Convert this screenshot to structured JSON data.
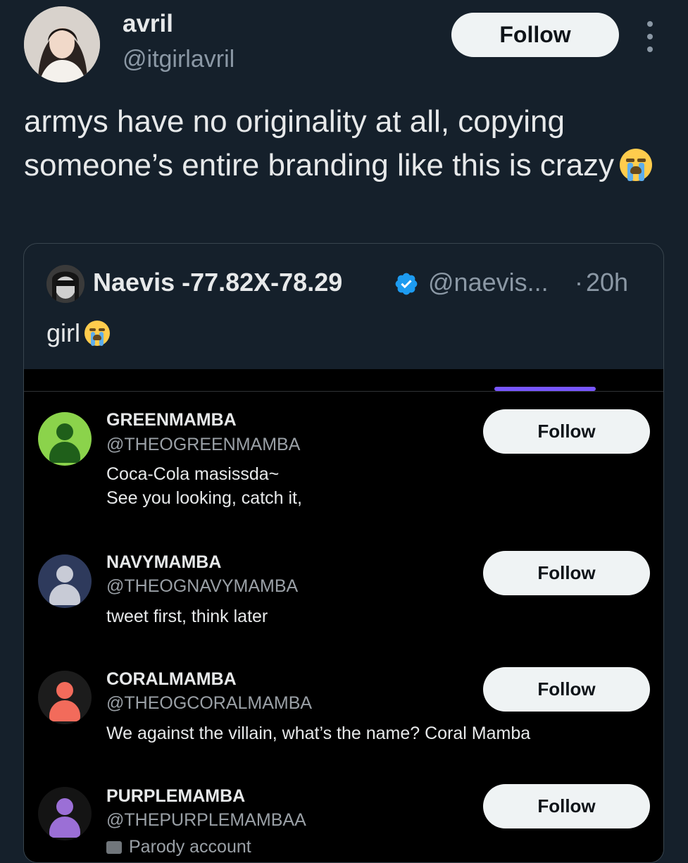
{
  "author": {
    "display_name": "avril",
    "handle": "@itgirlavril",
    "follow_label": "Follow"
  },
  "tweet": {
    "text": "armys have no originality at all, copying someone’s entire branding like this is crazy",
    "emoji": "loudly-crying-face"
  },
  "quoted": {
    "display_name": "Naevis -77.82X-78.29",
    "handle": "@naevis...",
    "separator": "·",
    "time": "20h",
    "text": "girl",
    "emoji": "loudly-crying-face",
    "verified_color": "#1d9bf0",
    "accounts": [
      {
        "name": "GREENMAMBA",
        "handle": "@THEOGREENMAMBA",
        "bio": "Coca-Cola masissda~\nSee you looking, catch it,",
        "follow_label": "Follow",
        "avatar_color": "#8bd34b",
        "avatar_figure": "#1f5f1a"
      },
      {
        "name": "NAVYMAMBA",
        "handle": "@THEOGNAVYMAMBA",
        "bio": "tweet first, think later",
        "follow_label": "Follow",
        "avatar_color": "#2e3a5c",
        "avatar_figure": "#c8cbd6"
      },
      {
        "name": "CORALMAMBA",
        "handle": "@THEOGCORALMAMBA",
        "bio": "We against the villain, what’s the name? Coral Mamba",
        "follow_label": "Follow",
        "avatar_color": "#1c1c1c",
        "avatar_figure": "#f26b5b"
      },
      {
        "name": "PURPLEMAMBA",
        "handle": "@THEPURPLEMAMBAA",
        "bio": "Parody account",
        "follow_label": "Follow",
        "avatar_color": "#141414",
        "avatar_figure": "#9b6fd6"
      }
    ]
  }
}
